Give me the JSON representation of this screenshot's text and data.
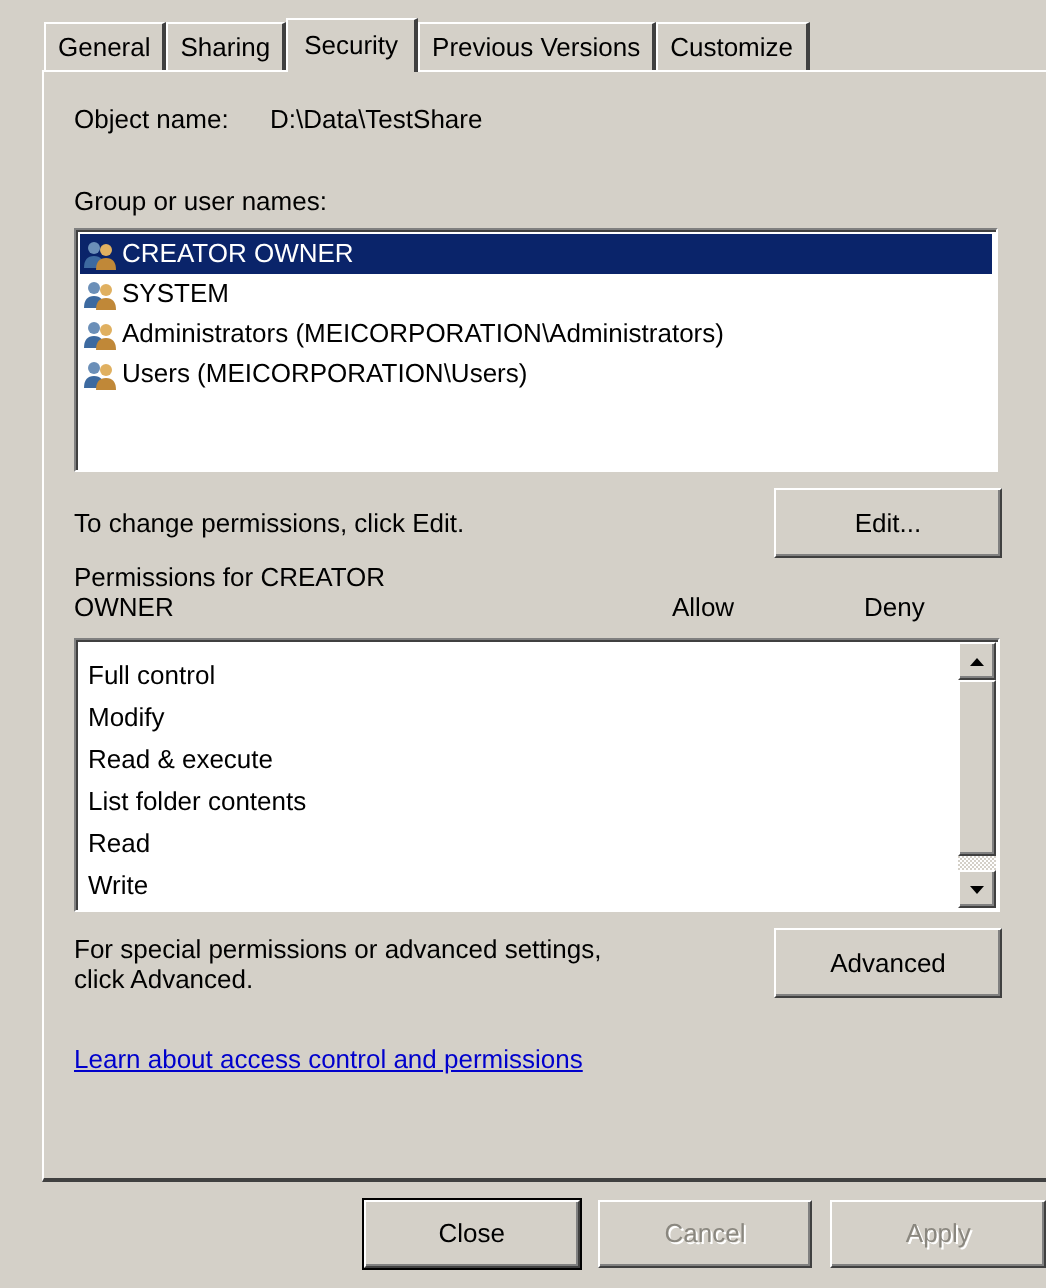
{
  "tabs": [
    {
      "label": "General",
      "selected": false
    },
    {
      "label": "Sharing",
      "selected": false
    },
    {
      "label": "Security",
      "selected": true
    },
    {
      "label": "Previous Versions",
      "selected": false
    },
    {
      "label": "Customize",
      "selected": false
    }
  ],
  "object_name": {
    "label": "Object name:",
    "value": "D:\\Data\\TestShare"
  },
  "groups": {
    "label": "Group or user names:",
    "items": [
      {
        "name": "CREATOR OWNER",
        "selected": true
      },
      {
        "name": "SYSTEM",
        "selected": false
      },
      {
        "name": "Administrators (MEICORPORATION\\Administrators)",
        "selected": false
      },
      {
        "name": "Users (MEICORPORATION\\Users)",
        "selected": false
      }
    ]
  },
  "change_hint": "To change permissions, click Edit.",
  "edit_button": "Edit...",
  "permissions": {
    "label": "Permissions for CREATOR OWNER",
    "columns": [
      "Allow",
      "Deny"
    ],
    "rows": [
      "Full control",
      "Modify",
      "Read & execute",
      "List folder contents",
      "Read",
      "Write"
    ]
  },
  "advanced_hint": "For special permissions or advanced settings, click Advanced.",
  "advanced_button": "Advanced",
  "link": "Learn about access control and permissions",
  "buttons": [
    {
      "label": "Close",
      "disabled": false,
      "default": true
    },
    {
      "label": "Cancel",
      "disabled": true,
      "default": false
    },
    {
      "label": "Apply",
      "disabled": true,
      "default": false
    }
  ]
}
